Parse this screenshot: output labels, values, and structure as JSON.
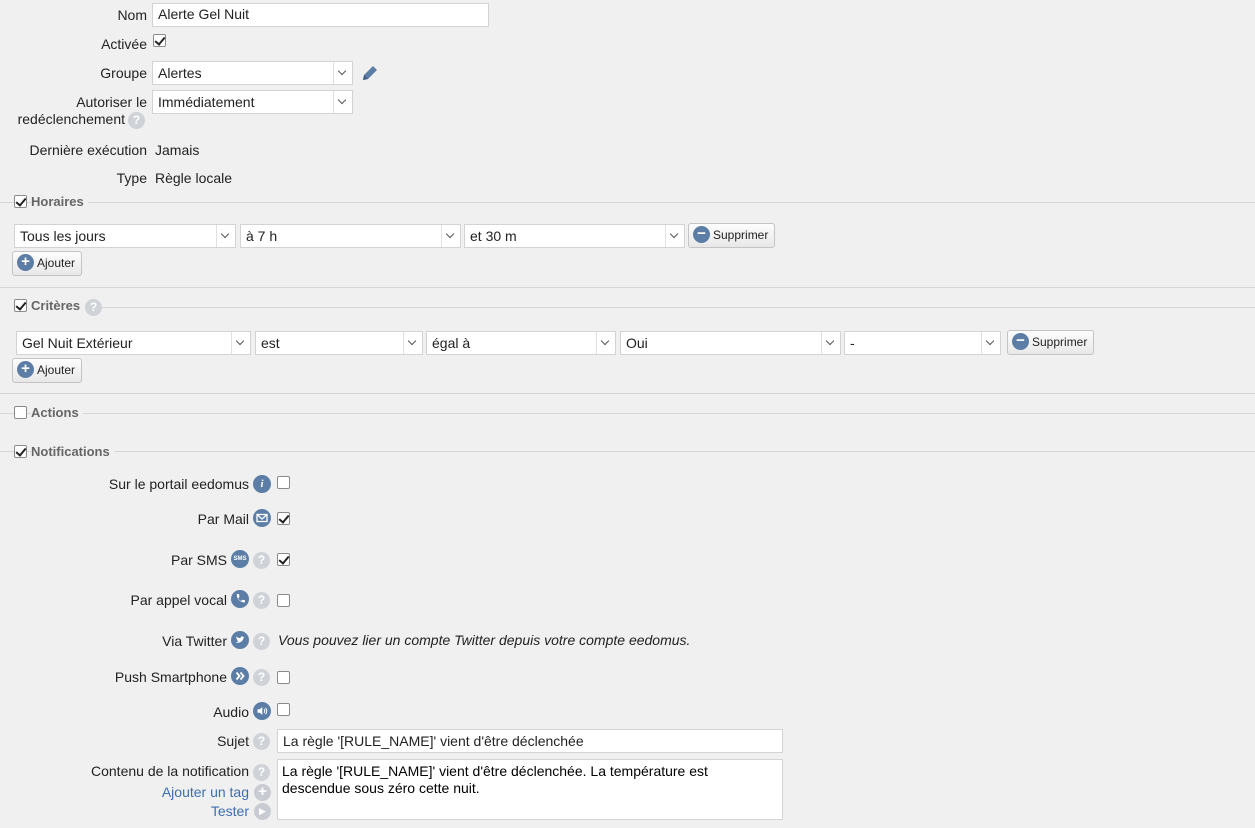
{
  "general": {
    "name_label": "Nom",
    "name_value": "Alerte Gel Nuit",
    "enabled_label": "Activée",
    "group_label": "Groupe",
    "group_value": "Alertes",
    "retrigger_label_1": "Autoriser le",
    "retrigger_label_2": "redéclenchement",
    "retrigger_value": "Immédiatement",
    "last_run_label": "Dernière exécution",
    "last_run_value": "Jamais",
    "type_label": "Type",
    "type_value": "Règle locale"
  },
  "schedules": {
    "title": "Horaires",
    "day": "Tous les jours",
    "hour": "à 7 h",
    "minute": "et 30 m",
    "delete_label": "Supprimer",
    "add_label": "Ajouter"
  },
  "criteria": {
    "title": "Critères",
    "device": "Gel Nuit Extérieur",
    "verb": "est",
    "operator": "égal à",
    "value": "Oui",
    "extra": "-",
    "delete_label": "Supprimer",
    "add_label": "Ajouter"
  },
  "actions": {
    "title": "Actions"
  },
  "notifications": {
    "title": "Notifications",
    "portal_label": "Sur le portail eedomus",
    "mail_label": "Par Mail",
    "sms_label": "Par SMS",
    "sms_icon_text": "SMS",
    "voice_label": "Par appel vocal",
    "twitter_label": "Via Twitter",
    "twitter_note": "Vous pouvez lier un compte Twitter depuis votre compte eedomus.",
    "push_label": "Push Smartphone",
    "audio_label": "Audio",
    "subject_label": "Sujet",
    "subject_value": "La règle '[RULE_NAME]' vient d'être déclenchée",
    "content_label": "Contenu de la notification",
    "content_value": "La règle '[RULE_NAME]' vient d'être déclenchée. La température est descendue sous zéro cette nuit.",
    "add_tag_label": "Ajouter un tag",
    "test_label": "Tester"
  },
  "colors": {
    "accent": "#5c7ea6",
    "link": "#3b6fb1",
    "background": "#f0f0f0"
  }
}
